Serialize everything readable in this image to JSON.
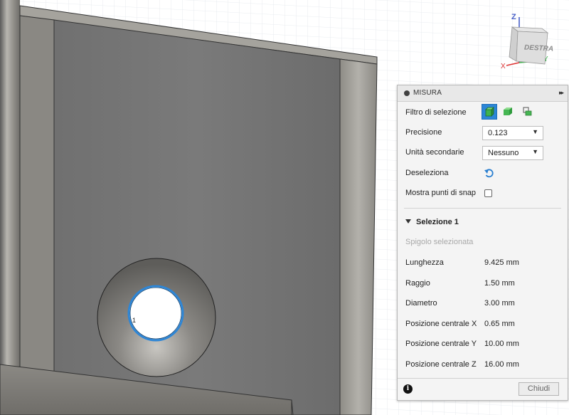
{
  "viewcube": {
    "face_label": "DESTRA",
    "axis_z": "Z",
    "axis_x": "X",
    "axis_y": "Y"
  },
  "viewport": {
    "hole_label": "1"
  },
  "panel": {
    "title": "MISURA",
    "expand_glyph": "▸▸",
    "settings": {
      "selection_filter_label": "Filtro di selezione",
      "precision_label": "Precisione",
      "precision_value": "0.123",
      "secondary_units_label": "Unità secondarie",
      "secondary_units_value": "Nessuno",
      "deselect_label": "Deseleziona",
      "show_snap_label": "Mostra punti di snap",
      "show_snap_checked": false
    },
    "selection": {
      "title": "Selezione 1",
      "subtitle": "Spigolo selezionata",
      "rows": [
        {
          "label": "Lunghezza",
          "value": "9.425 mm"
        },
        {
          "label": "Raggio",
          "value": "1.50 mm"
        },
        {
          "label": "Diametro",
          "value": "3.00 mm"
        },
        {
          "label": "Posizione centrale X",
          "value": "0.65 mm"
        },
        {
          "label": "Posizione centrale Y",
          "value": "10.00 mm"
        },
        {
          "label": "Posizione centrale Z",
          "value": "16.00 mm"
        }
      ]
    },
    "footer": {
      "info_glyph": "i",
      "close_label": "Chiudi"
    }
  }
}
